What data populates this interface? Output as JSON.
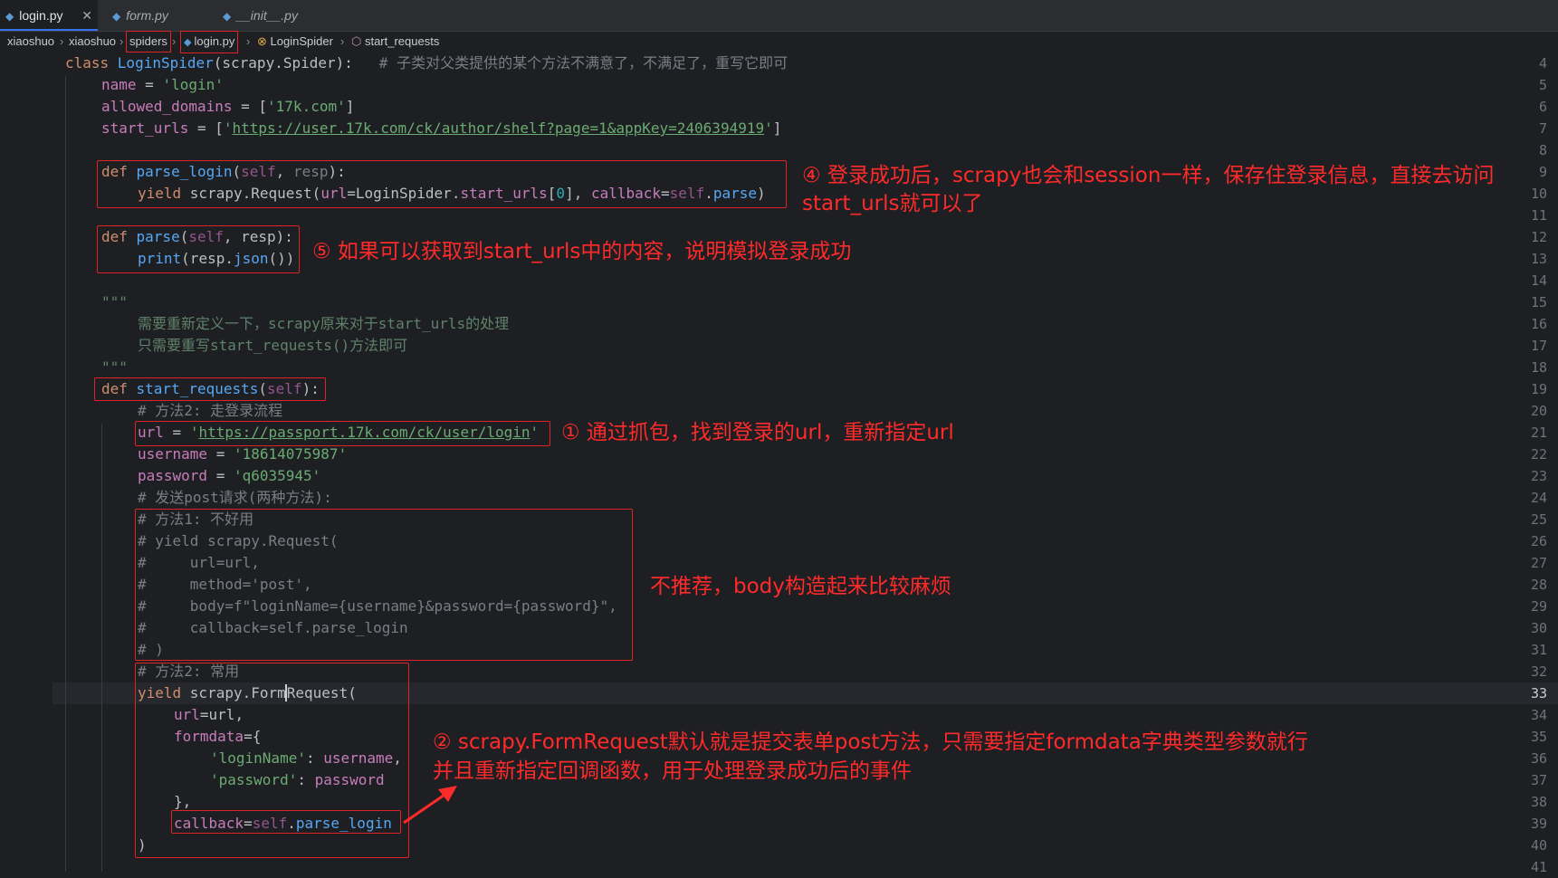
{
  "tabs": [
    {
      "label": "login.py",
      "active": true,
      "close": "✕"
    },
    {
      "label": "form.py",
      "active": false
    },
    {
      "label": "__init__.py",
      "active": false
    }
  ],
  "breadcrumb": [
    "xiaoshuo",
    "xiaoshuo",
    "spiders",
    "login.py",
    "LoginSpider",
    "start_requests"
  ],
  "line_numbers": [
    "4",
    "5",
    "6",
    "7",
    "8",
    "9",
    "10",
    "11",
    "12",
    "13",
    "14",
    "15",
    "16",
    "17",
    "18",
    "19",
    "20",
    "21",
    "22",
    "23",
    "24",
    "25",
    "26",
    "27",
    "28",
    "29",
    "30",
    "31",
    "32",
    "33",
    "34",
    "35",
    "36",
    "37",
    "38",
    "39",
    "40",
    "41"
  ],
  "current_line": "33",
  "code": {
    "l4": {
      "kw": "class ",
      "name": "LoginSpider",
      "paren": "(scrapy.Spider):",
      "comment": "# 子类对父类提供的某个方法不满意了，不满足了，重写它即可"
    },
    "l5": {
      "var": "name",
      "eq": " = ",
      "val": "'login'"
    },
    "l6": {
      "var": "allowed_domains",
      "eq": " = [",
      "val": "'17k.com'",
      "end": "]"
    },
    "l7": {
      "var": "start_urls",
      "eq": " = [",
      "q1": "'",
      "url": "https://user.17k.com/ck/author/shelf?page=1&appKey=2406394919",
      "q2": "'",
      "end": "]"
    },
    "l9": {
      "kw": "def ",
      "name": "parse_login",
      "open": "(",
      "self": "self",
      "sep": ", ",
      "param": "resp",
      "close": "):"
    },
    "l10": {
      "kw": "yield ",
      "a": "scrapy.",
      "b": "Request",
      "c": "(",
      "k1": "url",
      "d": "=LoginSpider.",
      "e": "start_urls",
      "f": "[",
      "n": "0",
      "g": "], ",
      "k2": "callback",
      "h": "=",
      "self": "self",
      "i": ".",
      "j": "parse",
      "k": ")"
    },
    "l12": {
      "kw": "def ",
      "name": "parse",
      "open": "(",
      "self": "self",
      "sep": ", ",
      "param": "resp",
      "close": "):"
    },
    "l13": {
      "a": "print",
      "b": "(resp.",
      "c": "json",
      "d": "())"
    },
    "l15": {
      "doc": "\"\"\""
    },
    "l16": {
      "doc": "需要重新定义一下，scrapy原来对于start_urls的处理"
    },
    "l17": {
      "doc": "只需要重写start_requests()方法即可"
    },
    "l18": {
      "doc": "\"\"\""
    },
    "l19": {
      "kw": "def ",
      "name": "start_requests",
      "open": "(",
      "self": "self",
      "close": "):"
    },
    "l20": {
      "cmt": "# 方法2: 走登录流程"
    },
    "l21": {
      "var": "url",
      "eq": " = ",
      "q1": "'",
      "url": "https://passport.17k.com/ck/user/login",
      "q2": "'"
    },
    "l22": {
      "var": "username",
      "eq": " = ",
      "val": "'18614075987'"
    },
    "l23": {
      "var": "password",
      "eq": " = ",
      "val": "'q6035945'"
    },
    "l24": {
      "cmt": "# 发送post请求(两种方法):"
    },
    "l25": {
      "cmt": "# 方法1: 不好用"
    },
    "l26": {
      "cmt": "# yield scrapy.Request("
    },
    "l27": {
      "cmt": "#     url=url,"
    },
    "l28": {
      "cmt": "#     method='post',"
    },
    "l29": {
      "cmt": "#     body=f\"loginName={username}&password={password}\","
    },
    "l30": {
      "cmt": "#     callback=self.parse_login"
    },
    "l31": {
      "cmt": "# )"
    },
    "l32": {
      "cmt": "# 方法2: 常用"
    },
    "l33": {
      "kw": "yield ",
      "a": "scrapy.",
      "b1": "Form",
      "b2": "Request",
      "c": "("
    },
    "l34": {
      "k": "url",
      "v": "=url,"
    },
    "l35": {
      "k": "formdata",
      "v": "={"
    },
    "l36": {
      "s": "'loginName'",
      "v": ": ",
      "var": "username",
      "end": ","
    },
    "l37": {
      "s": "'password'",
      "v": ": ",
      "var": "password"
    },
    "l38": {
      "v": "},"
    },
    "l39": {
      "k": "callback",
      "eq": "=",
      "self": "self",
      "dot": ".",
      "m": "parse_login"
    },
    "l40": {
      "v": ")"
    }
  },
  "notes": {
    "n4a": "④ 登录成功后，scrapy也会和session一样，保存住登录信息，直接去访问",
    "n4b": "start_urls就可以了",
    "n5": "⑤ 如果可以获取到start_urls中的内容，说明模拟登录成功",
    "n1": "① 通过抓包，找到登录的url，重新指定url",
    "nbad": "不推荐，body构造起来比较麻烦",
    "n2a": "② scrapy.FormRequest默认就是提交表单post方法，只需要指定formdata字典类型参数就行",
    "n2b": "并且重新指定回调函数，用于处理登录成功后的事件"
  },
  "colors": {
    "annotation": "#e02424",
    "background": "#1e1f22"
  }
}
